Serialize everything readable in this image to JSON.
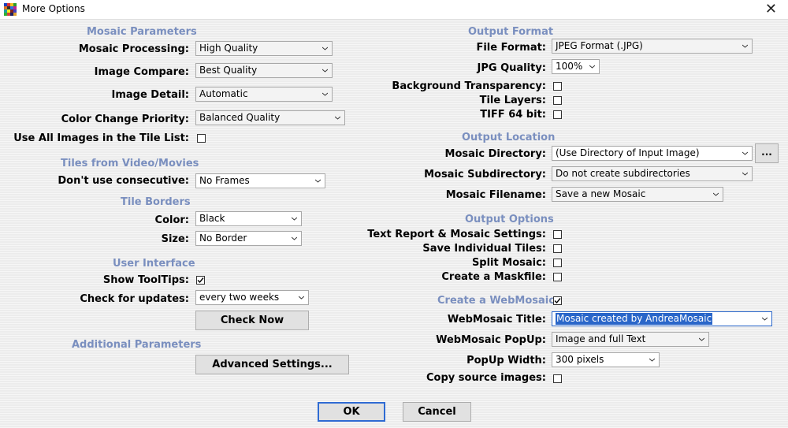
{
  "window": {
    "title": "More Options"
  },
  "mosaic_parameters": {
    "header": "Mosaic Parameters",
    "processing": {
      "label": "Mosaic Processing:",
      "value": "High Quality"
    },
    "compare": {
      "label": "Image Compare:",
      "value": "Best Quality"
    },
    "detail": {
      "label": "Image Detail:",
      "value": "Automatic"
    },
    "color_priority": {
      "label": "Color Change Priority:",
      "value": "Balanced Quality"
    },
    "use_all": {
      "label": "Use All Images in the Tile List:",
      "checked": false
    }
  },
  "tiles_video": {
    "header": "Tiles from Video/Movies",
    "consecutive": {
      "label": "Don't use consecutive:",
      "value": "No Frames"
    }
  },
  "tile_borders": {
    "header": "Tile Borders",
    "color": {
      "label": "Color:",
      "value": "Black"
    },
    "size": {
      "label": "Size:",
      "value": "No Border"
    }
  },
  "user_interface": {
    "header": "User Interface",
    "tooltips": {
      "label": "Show ToolTips:",
      "checked": true
    },
    "updates": {
      "label": "Check for updates:",
      "value": "every two weeks"
    },
    "check_now": "Check Now"
  },
  "additional": {
    "header": "Additional Parameters",
    "advanced": "Advanced Settings..."
  },
  "output_format": {
    "header": "Output Format",
    "file_format": {
      "label": "File Format:",
      "value": "JPEG Format (.JPG)"
    },
    "jpg_quality": {
      "label": "JPG Quality:",
      "value": "100%"
    },
    "bg_transparency": {
      "label": "Background Transparency:",
      "checked": false
    },
    "tile_layers": {
      "label": "Tile Layers:",
      "checked": false
    },
    "tiff64": {
      "label": "TIFF 64 bit:",
      "checked": false
    }
  },
  "output_location": {
    "header": "Output Location",
    "directory": {
      "label": "Mosaic Directory:",
      "value": "(Use Directory of Input Image)"
    },
    "browse": "...",
    "subdirectory": {
      "label": "Mosaic Subdirectory:",
      "value": "Do not create subdirectories"
    },
    "filename": {
      "label": "Mosaic Filename:",
      "value": "Save a new Mosaic"
    }
  },
  "output_options": {
    "header": "Output Options",
    "text_report": {
      "label": "Text Report & Mosaic Settings:",
      "checked": false
    },
    "individual_tiles": {
      "label": "Save Individual Tiles:",
      "checked": false
    },
    "split": {
      "label": "Split Mosaic:",
      "checked": false
    },
    "maskfile": {
      "label": "Create a Maskfile:",
      "checked": false
    }
  },
  "webmosaic": {
    "header": "Create a WebMosaic",
    "enabled": true,
    "title": {
      "label": "WebMosaic Title:",
      "value": "Mosaic created by AndreaMosaic"
    },
    "popup": {
      "label": "WebMosaic PopUp:",
      "value": "Image and full Text"
    },
    "popup_width": {
      "label": "PopUp Width:",
      "value": "300 pixels"
    },
    "copy_source": {
      "label": "Copy source images:",
      "checked": false
    }
  },
  "footer": {
    "ok": "OK",
    "cancel": "Cancel"
  },
  "colors": {
    "header": "#7a8fbf",
    "accent": "#2a66c9"
  }
}
